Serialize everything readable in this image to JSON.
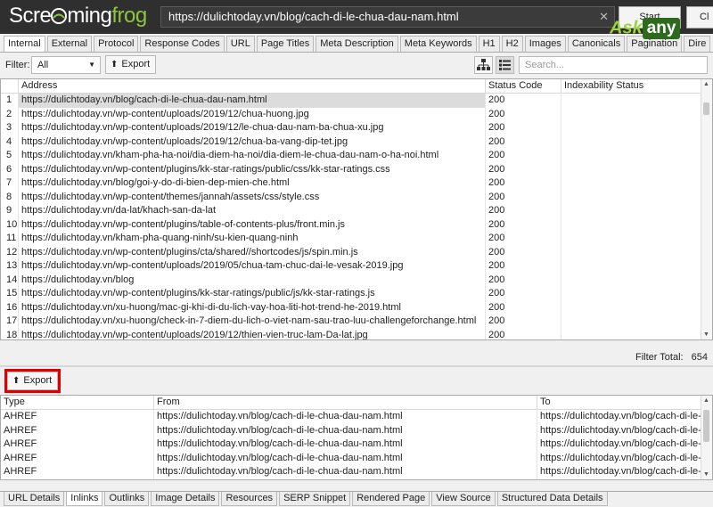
{
  "app": {
    "logo_pre": "Scre",
    "logo_mid": "ming",
    "logo_frog": "frog",
    "url": "https://dulichtoday.vn/blog/cach-di-le-chua-dau-nam.html",
    "start_label": "Start",
    "clear_label": "Cl",
    "watermark_ask": "Ask",
    "watermark_any": "any"
  },
  "top_tabs": [
    "Internal",
    "External",
    "Protocol",
    "Response Codes",
    "URL",
    "Page Titles",
    "Meta Description",
    "Meta Keywords",
    "H1",
    "H2",
    "Images",
    "Canonicals",
    "Pagination",
    "Dire"
  ],
  "filter": {
    "label": "Filter:",
    "selected": "All",
    "export_label": "Export",
    "search_placeholder": "Search..."
  },
  "main_table": {
    "columns": [
      "Address",
      "Status Code",
      "Indexability Status"
    ],
    "rows": [
      {
        "n": "1",
        "address": "https://dulichtoday.vn/blog/cach-di-le-chua-dau-nam.html",
        "status": "200"
      },
      {
        "n": "2",
        "address": "https://dulichtoday.vn/wp-content/uploads/2019/12/chua-huong.jpg",
        "status": "200"
      },
      {
        "n": "3",
        "address": "https://dulichtoday.vn/wp-content/uploads/2019/12/le-chua-dau-nam-ba-chua-xu.jpg",
        "status": "200"
      },
      {
        "n": "4",
        "address": "https://dulichtoday.vn/wp-content/uploads/2019/12/chua-ba-vang-dip-tet.jpg",
        "status": "200"
      },
      {
        "n": "5",
        "address": "https://dulichtoday.vn/kham-pha-ha-noi/dia-diem-ha-noi/dia-diem-le-chua-dau-nam-o-ha-noi.html",
        "status": "200"
      },
      {
        "n": "6",
        "address": "https://dulichtoday.vn/wp-content/plugins/kk-star-ratings/public/css/kk-star-ratings.css",
        "status": "200"
      },
      {
        "n": "7",
        "address": "https://dulichtoday.vn/blog/goi-y-do-di-bien-dep-mien-che.html",
        "status": "200"
      },
      {
        "n": "8",
        "address": "https://dulichtoday.vn/wp-content/themes/jannah/assets/css/style.css",
        "status": "200"
      },
      {
        "n": "9",
        "address": "https://dulichtoday.vn/da-lat/khach-san-da-lat",
        "status": "200"
      },
      {
        "n": "10",
        "address": "https://dulichtoday.vn/wp-content/plugins/table-of-contents-plus/front.min.js",
        "status": "200"
      },
      {
        "n": "11",
        "address": "https://dulichtoday.vn/kham-pha-quang-ninh/su-kien-quang-ninh",
        "status": "200"
      },
      {
        "n": "12",
        "address": "https://dulichtoday.vn/wp-content/plugins/cta/shared//shortcodes/js/spin.min.js",
        "status": "200"
      },
      {
        "n": "13",
        "address": "https://dulichtoday.vn/wp-content/uploads/2019/05/chua-tam-chuc-dai-le-vesak-2019.jpg",
        "status": "200"
      },
      {
        "n": "14",
        "address": "https://dulichtoday.vn/blog",
        "status": "200"
      },
      {
        "n": "15",
        "address": "https://dulichtoday.vn/wp-content/plugins/kk-star-ratings/public/js/kk-star-ratings.js",
        "status": "200"
      },
      {
        "n": "16",
        "address": "https://dulichtoday.vn/xu-huong/mac-gi-khi-di-du-lich-vay-hoa-liti-hot-trend-he-2019.html",
        "status": "200"
      },
      {
        "n": "17",
        "address": "https://dulichtoday.vn/xu-huong/check-in-7-diem-du-lich-o-viet-nam-sau-trao-luu-challengeforchange.html",
        "status": "200"
      },
      {
        "n": "18",
        "address": "https://dulichtoday.vn/wp-content/uploads/2019/12/thien-vien-truc-lam-Da-lat.jpg",
        "status": "200"
      }
    ]
  },
  "filter_total": {
    "label": "Filter Total:",
    "value": "654"
  },
  "detail": {
    "export_label": "Export",
    "columns": [
      "Type",
      "From",
      "To"
    ],
    "rows": [
      {
        "type": "AHREF",
        "from": "https://dulichtoday.vn/blog/cach-di-le-chua-dau-nam.html",
        "to": "https://dulichtoday.vn/blog/cach-di-le-chu"
      },
      {
        "type": "AHREF",
        "from": "https://dulichtoday.vn/blog/cach-di-le-chua-dau-nam.html",
        "to": "https://dulichtoday.vn/blog/cach-di-le-chu"
      },
      {
        "type": "AHREF",
        "from": "https://dulichtoday.vn/blog/cach-di-le-chua-dau-nam.html",
        "to": "https://dulichtoday.vn/blog/cach-di-le-chu"
      },
      {
        "type": "AHREF",
        "from": "https://dulichtoday.vn/blog/cach-di-le-chua-dau-nam.html",
        "to": "https://dulichtoday.vn/blog/cach-di-le-chu"
      },
      {
        "type": "AHREF",
        "from": "https://dulichtoday.vn/blog/cach-di-le-chua-dau-nam.html",
        "to": "https://dulichtoday.vn/blog/cach-di-le-chu"
      }
    ]
  },
  "bottom_tabs": [
    "URL Details",
    "Inlinks",
    "Outlinks",
    "Image Details",
    "Resources",
    "SERP Snippet",
    "Rendered Page",
    "View Source",
    "Structured Data Details"
  ],
  "colors": {
    "header_bg": "#2f2f2f",
    "frog_green": "#8cc63f",
    "highlight_red": "#e00000"
  }
}
